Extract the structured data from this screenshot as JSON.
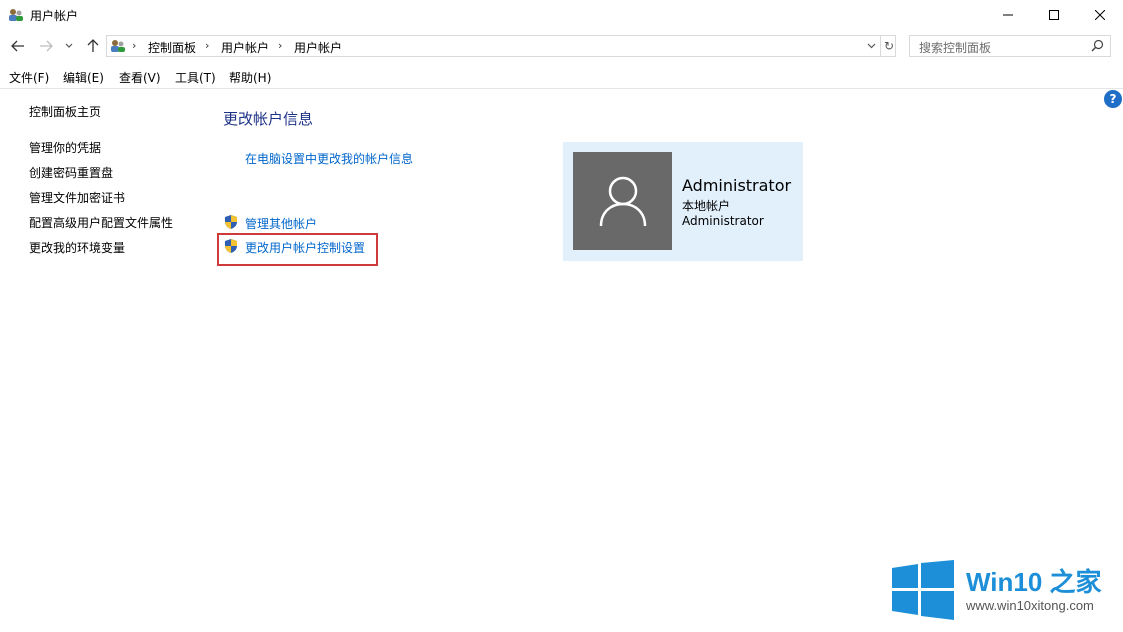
{
  "window": {
    "title": "用户帐户"
  },
  "breadcrumb": {
    "items": [
      "控制面板",
      "用户帐户",
      "用户帐户"
    ],
    "separator": "›"
  },
  "search": {
    "placeholder": "搜索控制面板"
  },
  "menu": [
    "文件(F)",
    "编辑(E)",
    "查看(V)",
    "工具(T)",
    "帮助(H)"
  ],
  "sidebar": {
    "home": "控制面板主页",
    "links": [
      "管理你的凭据",
      "创建密码重置盘",
      "管理文件加密证书",
      "配置高级用户配置文件属性",
      "更改我的环境变量"
    ]
  },
  "main": {
    "title": "更改帐户信息",
    "pc_settings_link": "在电脑设置中更改我的帐户信息",
    "manage_other": "管理其他帐户",
    "uac_settings": "更改用户帐户控制设置"
  },
  "account": {
    "name": "Administrator",
    "type": "本地帐户",
    "group": "Administrator"
  },
  "help": {
    "label": "?"
  },
  "watermark": {
    "title": "Win10 之家",
    "url": "www.win10xitong.com"
  },
  "colors": {
    "link": "#0066cc",
    "title": "#1e3287",
    "highlight": "#cf3a3a",
    "tile": "#e2f0fb",
    "avatar": "#696969",
    "brand": "#1c8fd8"
  }
}
